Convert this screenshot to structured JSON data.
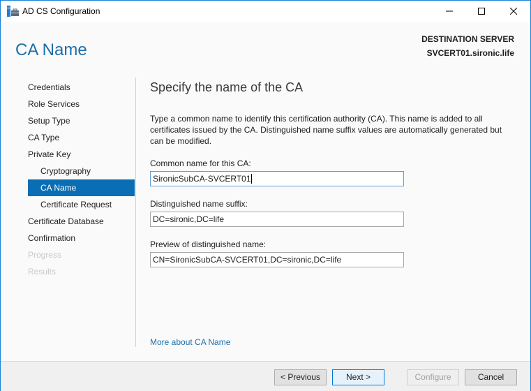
{
  "window": {
    "title": "AD CS Configuration",
    "accent_color": "#1883d7"
  },
  "header": {
    "page_title": "CA Name",
    "destination_label": "DESTINATION SERVER",
    "destination_server": "SVCERT01.sironic.life"
  },
  "nav": {
    "items": [
      {
        "label": "Credentials",
        "state": "normal",
        "level": 0
      },
      {
        "label": "Role Services",
        "state": "normal",
        "level": 0
      },
      {
        "label": "Setup Type",
        "state": "normal",
        "level": 0
      },
      {
        "label": "CA Type",
        "state": "normal",
        "level": 0
      },
      {
        "label": "Private Key",
        "state": "normal",
        "level": 0
      },
      {
        "label": "Cryptography",
        "state": "normal",
        "level": 1
      },
      {
        "label": "CA Name",
        "state": "selected",
        "level": 1
      },
      {
        "label": "Certificate Request",
        "state": "normal",
        "level": 1
      },
      {
        "label": "Certificate Database",
        "state": "normal",
        "level": 0
      },
      {
        "label": "Confirmation",
        "state": "normal",
        "level": 0
      },
      {
        "label": "Progress",
        "state": "disabled",
        "level": 0
      },
      {
        "label": "Results",
        "state": "disabled",
        "level": 0
      }
    ]
  },
  "content": {
    "section_title": "Specify the name of the CA",
    "description": "Type a common name to identify this certification authority (CA). This name is added to all certificates issued by the CA. Distinguished name suffix values are automatically generated but can be modified.",
    "common_name_label": "Common name for this CA:",
    "common_name_value": "SironicSubCA-SVCERT01",
    "dn_suffix_label": "Distinguished name suffix:",
    "dn_suffix_value": "DC=sironic,DC=life",
    "preview_label": "Preview of distinguished name:",
    "preview_value": "CN=SironicSubCA-SVCERT01,DC=sironic,DC=life",
    "more_link": "More about CA Name"
  },
  "footer": {
    "previous_label": "< Previous",
    "next_label": "Next >",
    "configure_label": "Configure",
    "cancel_label": "Cancel"
  }
}
